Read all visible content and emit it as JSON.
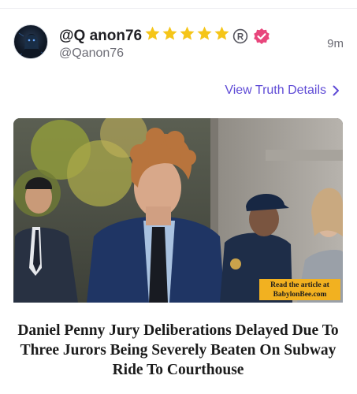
{
  "post": {
    "display_name": "@Q anon76",
    "star_count": 5,
    "handle": "@Qanon76",
    "timestamp": "9m",
    "details_link": "View Truth Details"
  },
  "article": {
    "promo_line1": "Read the article at",
    "promo_line2": "BabylonBee.com",
    "headline": "Daniel Penny Jury Deliberations Delayed Due To Three Jurors Being Severely Beaten On Subway Ride To Courthouse"
  },
  "colors": {
    "star": "#f5c518",
    "verified": "#e8467c",
    "accent": "#5f4bd6",
    "promo_bg": "#f2b120"
  },
  "icons": {
    "stars": "star-icon",
    "registered": "registered-icon",
    "verified": "verified-badge-icon",
    "chevron": "chevron-right-icon"
  }
}
